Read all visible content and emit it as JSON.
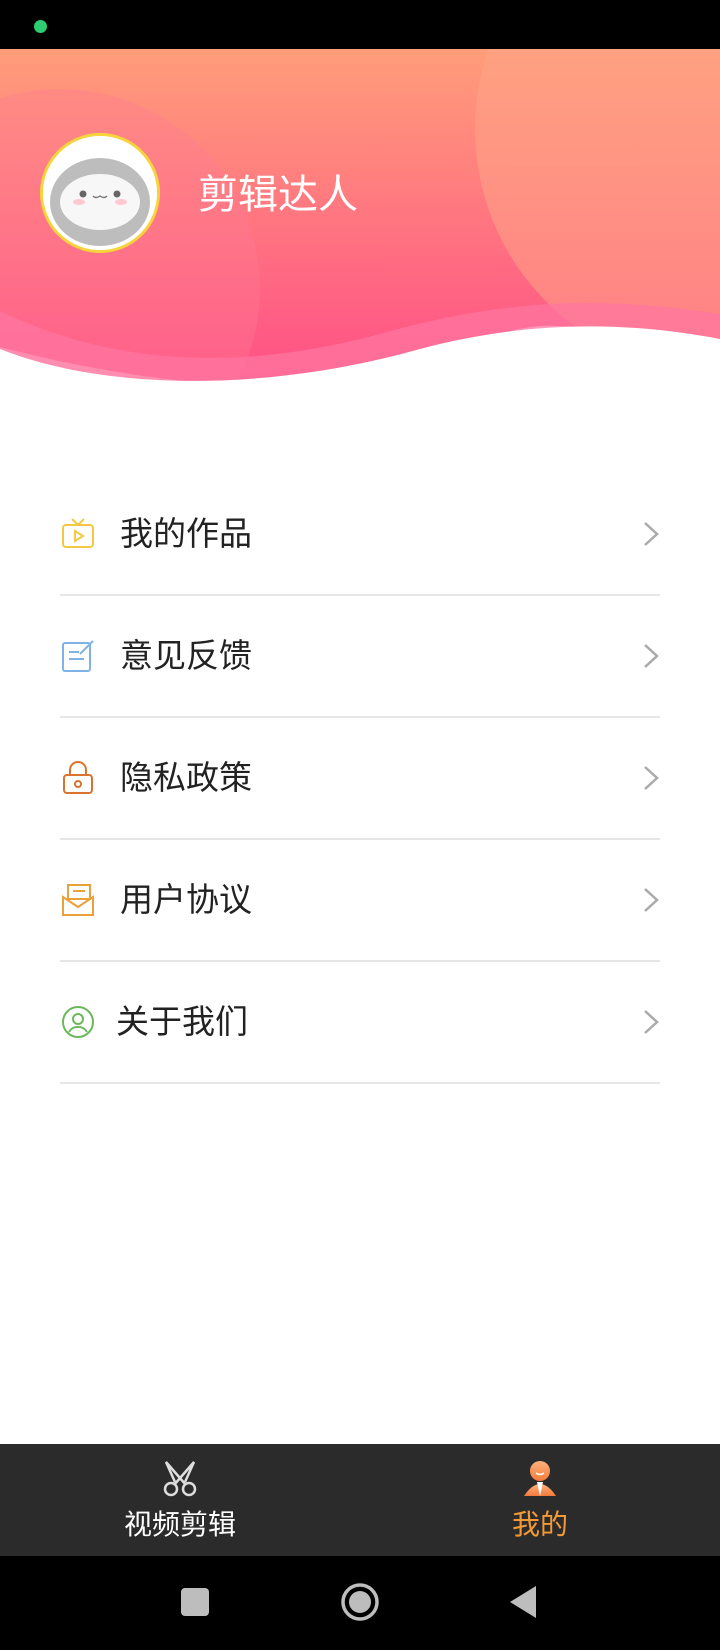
{
  "header": {
    "username": "剪辑达人"
  },
  "menu": {
    "items": [
      {
        "label": "我的作品",
        "icon": "tv-play-icon",
        "color": "#f4c842"
      },
      {
        "label": "意见反馈",
        "icon": "edit-note-icon",
        "color": "#7fb3e8"
      },
      {
        "label": "隐私政策",
        "icon": "lock-icon",
        "color": "#d9732e"
      },
      {
        "label": "用户协议",
        "icon": "mail-inbox-icon",
        "color": "#e9a13b"
      },
      {
        "label": "关于我们",
        "icon": "user-circle-icon",
        "color": "#6bb85a"
      }
    ]
  },
  "tabbar": {
    "video": {
      "label": "视频剪辑",
      "icon": "scissors-icon",
      "color": "#ffffff"
    },
    "mine": {
      "label": "我的",
      "icon": "person-icon",
      "color": "#f29a37",
      "active": true
    }
  },
  "colors": {
    "header_top": "#ff9a7b",
    "header_bottom": "#ff5a8a",
    "tabbar_bg": "#2b2b2b",
    "active": "#f29a37"
  }
}
